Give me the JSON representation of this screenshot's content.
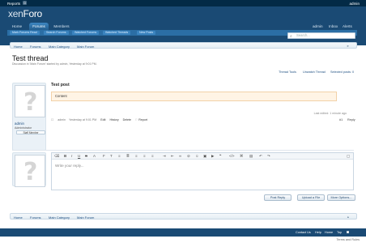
{
  "topbar": {
    "reports": "Reports",
    "reports_count": "0",
    "user": "admin"
  },
  "header": {
    "logo_a": "xen",
    "logo_b": "Foro"
  },
  "nav": {
    "tabs": [
      "Home",
      "Forums",
      "Members"
    ],
    "right": [
      "admin",
      "Inbox",
      "Alerts"
    ]
  },
  "subnav": {
    "items": [
      "Mark Forums Read",
      "Search Forums",
      "Watched Forums",
      "Watched Threads",
      "New Posts"
    ]
  },
  "search": {
    "placeholder": "Search..."
  },
  "breadcrumb": [
    "Home",
    "Forums",
    "Main Category",
    "Main Forum"
  ],
  "thread": {
    "title": "Test thread",
    "description": "Discussion in 'Main Forum' started by admin, Yesterday at 9:01 PM."
  },
  "thread_tools": {
    "tools": "Thread Tools",
    "unwatch": "Unwatch Thread",
    "selected": "Selected posts: 0"
  },
  "user": {
    "name": "admin",
    "title": "Administrator",
    "badge": "Staff Member"
  },
  "post": {
    "title": "Test post",
    "content": "Content",
    "edited": "Last edited: 1 minute ago",
    "author": "admin",
    "date": "Yesterday at 9:01 PM",
    "edit": "Edit",
    "history": "History",
    "delete": "Delete",
    "report": "Report",
    "number": "#1",
    "reply": "Reply"
  },
  "editor": {
    "placeholder": "Write your reply..."
  },
  "buttons": {
    "post_reply": "Post Reply",
    "upload": "Upload a File",
    "more": "More Options..."
  },
  "footer": {
    "links": [
      "Contact Us",
      "Help",
      "Home",
      "Top"
    ],
    "terms": "Terms and Rules"
  }
}
